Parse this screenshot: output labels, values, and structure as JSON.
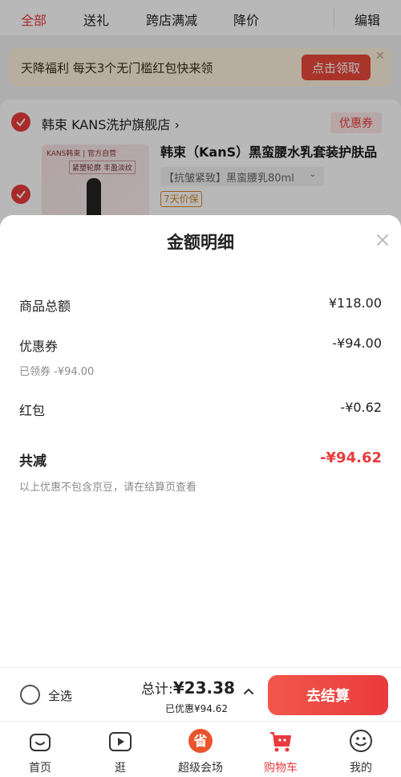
{
  "top_tabs": {
    "all": "全部",
    "gift": "送礼",
    "cross_store": "跨店满减",
    "price_drop": "降价",
    "edit": "编辑"
  },
  "promo": {
    "text": "天降福利 每天3个无门槛红包快来领",
    "button": "点击领取",
    "close": "✕"
  },
  "store": {
    "name": "韩束 KANS洗护旗舰店",
    "arrow": "›",
    "coupon_tag": "优惠券",
    "product": {
      "image_brand": "KANS韩束 | 官方自营",
      "image_slogan": "紧塑轮廓 丰盈淡纹",
      "title": "韩束（KanS）黑蛮腰水乳套装护肤品",
      "spec": "【抗皱紧致】黑蛮腰乳80ml",
      "tag": "7天价保"
    }
  },
  "sheet": {
    "title": "金额明细",
    "rows": {
      "goods_total_label": "商品总额",
      "goods_total_value": "¥118.00",
      "coupon_label": "优惠券",
      "coupon_value": "-¥94.00",
      "coupon_sub": "已领券 -¥94.00",
      "red_packet_label": "红包",
      "red_packet_value": "-¥0.62",
      "total_discount_label": "共减",
      "total_discount_value": "-¥94.62",
      "note": "以上优惠不包含京豆，请在结算页查看"
    }
  },
  "bottom_bar": {
    "select_all": "全选",
    "total_prefix": "总计:",
    "total_amount": "¥23.38",
    "saved": "已优惠¥94.62",
    "checkout": "去结算"
  },
  "nav": {
    "home": "首页",
    "browse": "逛",
    "super_venue": "超级会场",
    "super_venue_badge": "省",
    "cart": "购物车",
    "me": "我的"
  },
  "colors": {
    "accent": "#e93b3d",
    "promo_bg": "#fff1de",
    "text": "#222222",
    "muted": "#8a8a8a"
  }
}
